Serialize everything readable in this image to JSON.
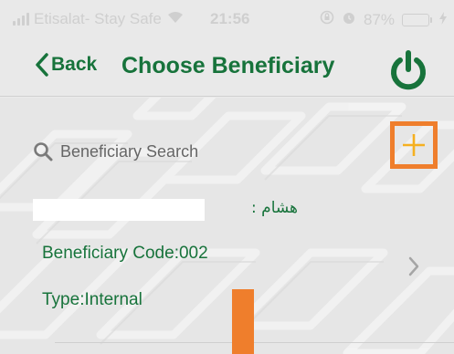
{
  "status_bar": {
    "carrier": "Etisalat- Stay Safe",
    "time": "21:56",
    "battery_percent": "87%",
    "battery_level": 0.87,
    "icons": [
      "signal-icon",
      "wifi-icon",
      "lock-rotation-icon",
      "alarm-icon",
      "battery-icon",
      "charging-icon"
    ]
  },
  "nav": {
    "back_label": "Back",
    "title": "Choose Beneficiary",
    "icons": [
      "chevron-left-icon",
      "power-icon"
    ]
  },
  "search": {
    "placeholder": "Beneficiary Search",
    "value": ""
  },
  "add_button": {
    "icon": "plus-icon"
  },
  "beneficiary": {
    "name": "هشام :",
    "code_line": "Beneficiary Code:002",
    "type_line": "Type:Internal"
  },
  "colors": {
    "brand_green": "#17733b",
    "highlight_orange": "#ef7e2c",
    "plus_orange": "#f5b020",
    "background": "#e9e9e9"
  }
}
